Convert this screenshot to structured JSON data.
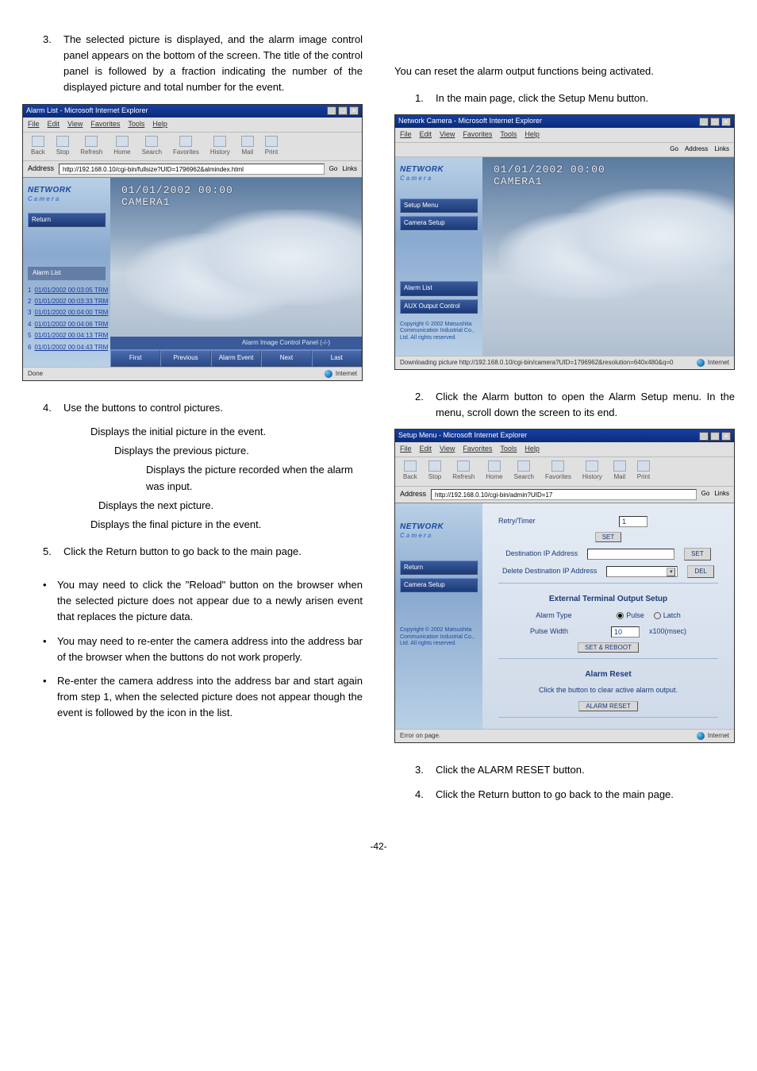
{
  "left": {
    "step3": "The selected picture is displayed, and the alarm image control panel appears on the bottom of the screen. The title of the control panel is followed by a fraction indicating the number of the displayed picture and total number for the event.",
    "step4_intro": "Use the buttons to control pictures.",
    "step4_lines": [
      "Displays the initial picture in the event.",
      "Displays the previous picture.",
      "Displays the picture recorded when the alarm was input.",
      "Displays the next picture.",
      "Displays the final picture in the event."
    ],
    "step5": "Click the Return button to go back to the main page.",
    "bullets": [
      "You may need to click the \"Reload\" button on the browser when the selected picture does not appear due to a newly arisen event that replaces the picture data.",
      "You may need to re-enter the camera address into the address bar of the browser when the buttons do not work properly.",
      "Re-enter the camera address into the address bar and start again from step 1, when the selected picture does not appear though the event is followed by the icon in the list."
    ]
  },
  "right": {
    "intro": "You can reset the alarm output functions being activated.",
    "step1": "In the main page, click the Setup Menu button.",
    "step2": "Click the Alarm button to open the Alarm Setup menu. In the menu, scroll down the screen to its end.",
    "step3": "Click the ALARM RESET button.",
    "step4": "Click the Return button to go back to the main page."
  },
  "browser_shared": {
    "menus": {
      "file": "File",
      "edit": "Edit",
      "view": "View",
      "fav": "Favorites",
      "tools": "Tools",
      "help": "Help"
    },
    "tbtns": {
      "back": "Back",
      "stop": "Stop",
      "refresh": "Refresh",
      "home": "Home",
      "search": "Search",
      "favorites": "Favorites",
      "history": "History",
      "mail": "Mail",
      "print": "Print"
    },
    "address_label": "Address",
    "go": "Go",
    "links": "Links",
    "done": "Done",
    "internet": "Internet",
    "error": "Error on page.",
    "logo1": "NETWORK",
    "logo2": "Camera",
    "return_btn": "Return",
    "camera_setup_btn": "Camera Setup",
    "overlay": "01/01/2002 00:00\nCAMERA1"
  },
  "b1": {
    "title": "Alarm List - Microsoft Internet Explorer",
    "addr": "http://192.168.0.10/cgi-bin/fullsize?UID=1796962&almindex.html",
    "alarm_list_label": "Alarm List",
    "rows": [
      {
        "n": "1",
        "ts": "01/01/2002 00:03:05 TRM"
      },
      {
        "n": "2",
        "ts": "01/01/2002 00:03:33 TRM"
      },
      {
        "n": "3",
        "ts": "01/01/2002 00:04:00 TRM"
      },
      {
        "n": "4",
        "ts": "01/01/2002 00:04:06 TRM"
      },
      {
        "n": "5",
        "ts": "01/01/2002 00:04:13 TRM"
      },
      {
        "n": "6",
        "ts": "01/01/2002 00:04:43 TRM"
      }
    ],
    "panel_title": "Alarm Image Control Panel (-/-)",
    "btns": {
      "first": "First",
      "previous": "Previous",
      "alarm_event": "Alarm Event",
      "next": "Next",
      "last": "Last"
    }
  },
  "b2": {
    "title": "Network Camera - Microsoft Internet Explorer",
    "addr_label_go": "Go",
    "address_label": "Address",
    "links": "Links",
    "setup_menu": "Setup Menu",
    "camera_setup": "Camera Setup",
    "alarm_list": "Alarm List",
    "aux": "AUX Output Control",
    "copyright": "Copyright © 2002 Matsushita Communication Industrial Co., Ltd. All rights reserved.",
    "status": "Downloading picture http://192.168.0.10/cgi-bin/camera?UID=1796962&resolution=640x480&q=0"
  },
  "b3": {
    "title": "Setup Menu - Microsoft Internet Explorer",
    "addr": "http://192.168.0.10/cgi-bin/admin?UID=17",
    "retry_timer": "Retry/Timer",
    "retry_val": "1",
    "set": "SET",
    "dest_ip": "Destination IP Address",
    "dest_ip_val": "",
    "delete_dest": "Delete Destination IP Address",
    "del": "DEL",
    "ext_setup": "External Terminal Output Setup",
    "alarm_type": "Alarm Type",
    "pulse": "Pulse",
    "latch": "Latch",
    "pulse_width": "Pulse Width",
    "pulse_val": "10",
    "pulse_unit": "x100(msec)",
    "set_reboot": "SET & REBOOT",
    "alarm_reset": "Alarm Reset",
    "alarm_reset_desc": "Click the button to clear active alarm output.",
    "alarm_reset_btn": "ALARM RESET",
    "copyright": "Copyright © 2002 Matsushita Communication Industrial Co., Ltd. All rights reserved."
  },
  "nums": {
    "n3": "3.",
    "n4": "4.",
    "n5": "5.",
    "n1": "1.",
    "n2": "2."
  },
  "bullet": "•",
  "page_num": "-42-"
}
